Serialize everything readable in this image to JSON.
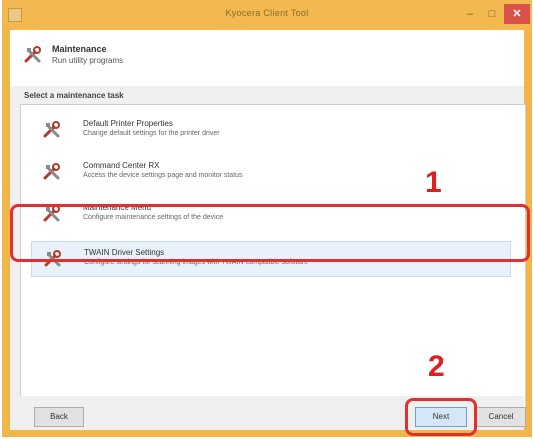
{
  "window": {
    "title": "Kyocera Client Tool",
    "minimize_glyph": "–",
    "maximize_glyph": "□",
    "close_glyph": "✕"
  },
  "header": {
    "title": "Maintenance",
    "subtitle": "Run utility programs",
    "icon": "tools-icon"
  },
  "section": {
    "label": "Select a maintenance task"
  },
  "items": [
    {
      "name": "Default Printer Properties",
      "desc": "Change default settings for the printer driver",
      "icon": "tools-icon"
    },
    {
      "name": "Command Center RX",
      "desc": "Access the device settings page and monitor status",
      "icon": "tools-icon"
    },
    {
      "name": "Maintenance Menu",
      "desc": "Configure maintenance settings of the device",
      "icon": "tools-icon"
    },
    {
      "name": "TWAIN Driver Settings",
      "desc": "Configure settings for scanning images with TWAIN-compatible software",
      "icon": "tools-icon"
    }
  ],
  "buttons": {
    "back": "Back",
    "next": "Next",
    "cancel": "Cancel"
  },
  "callouts": {
    "one": "1",
    "two": "2"
  },
  "colors": {
    "callout": "#e02020",
    "titlebar": "#f3b84f",
    "close": "#d9534a"
  }
}
